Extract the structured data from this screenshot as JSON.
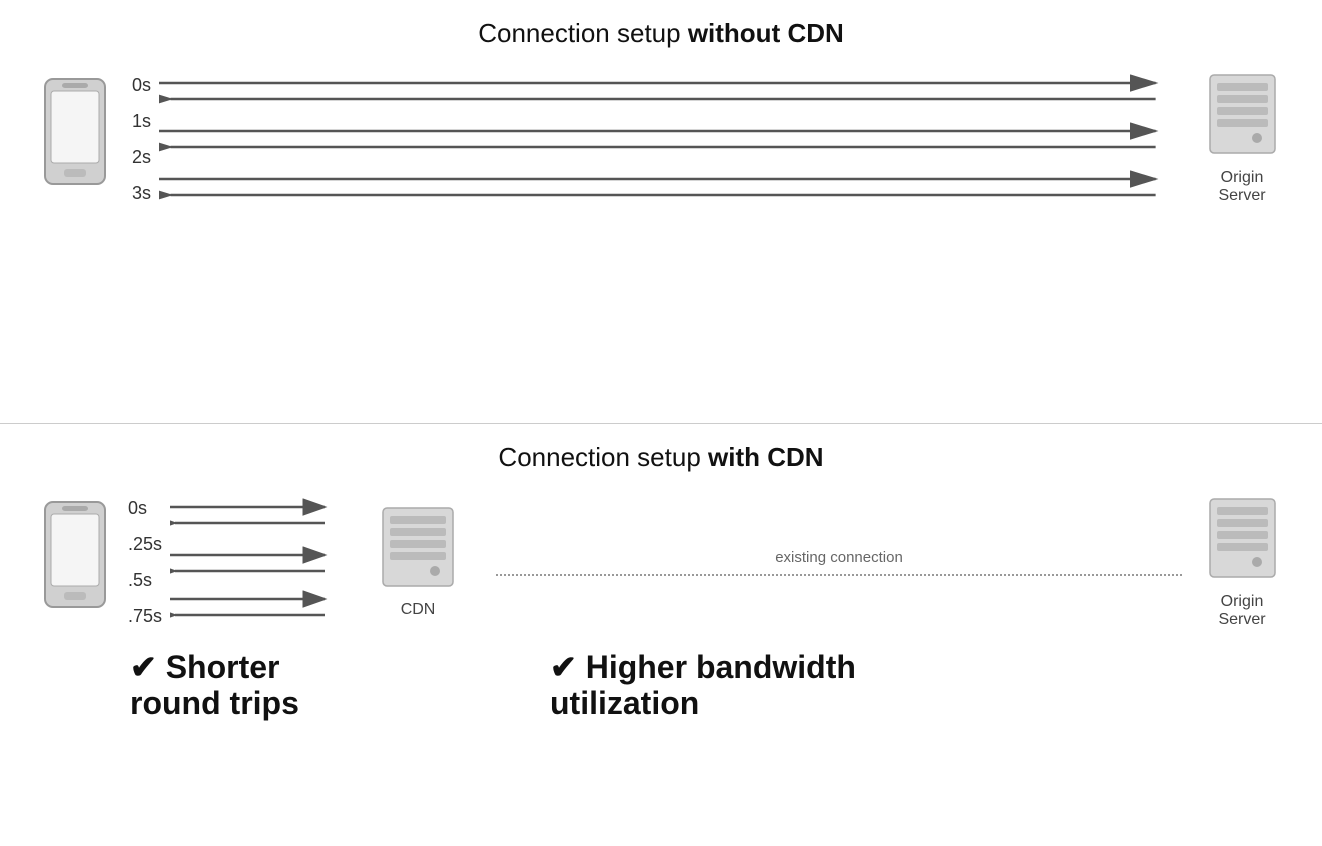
{
  "top": {
    "title_normal": "Connection setup ",
    "title_bold": "without CDN",
    "time_labels_left": [
      "0s",
      "1s",
      "2s",
      "3s"
    ],
    "server_label": "Origin\nServer"
  },
  "bottom": {
    "title_normal": "Connection setup ",
    "title_bold": "with CDN",
    "time_labels_left": [
      "0s",
      ".25s",
      ".5s",
      ".75s"
    ],
    "cdn_label": "CDN",
    "existing_connection": "existing connection",
    "server_label": "Origin\nServer",
    "benefit_left": "✔ Shorter\nround trips",
    "benefit_right": "✔ Higher bandwidth\nutilization"
  }
}
